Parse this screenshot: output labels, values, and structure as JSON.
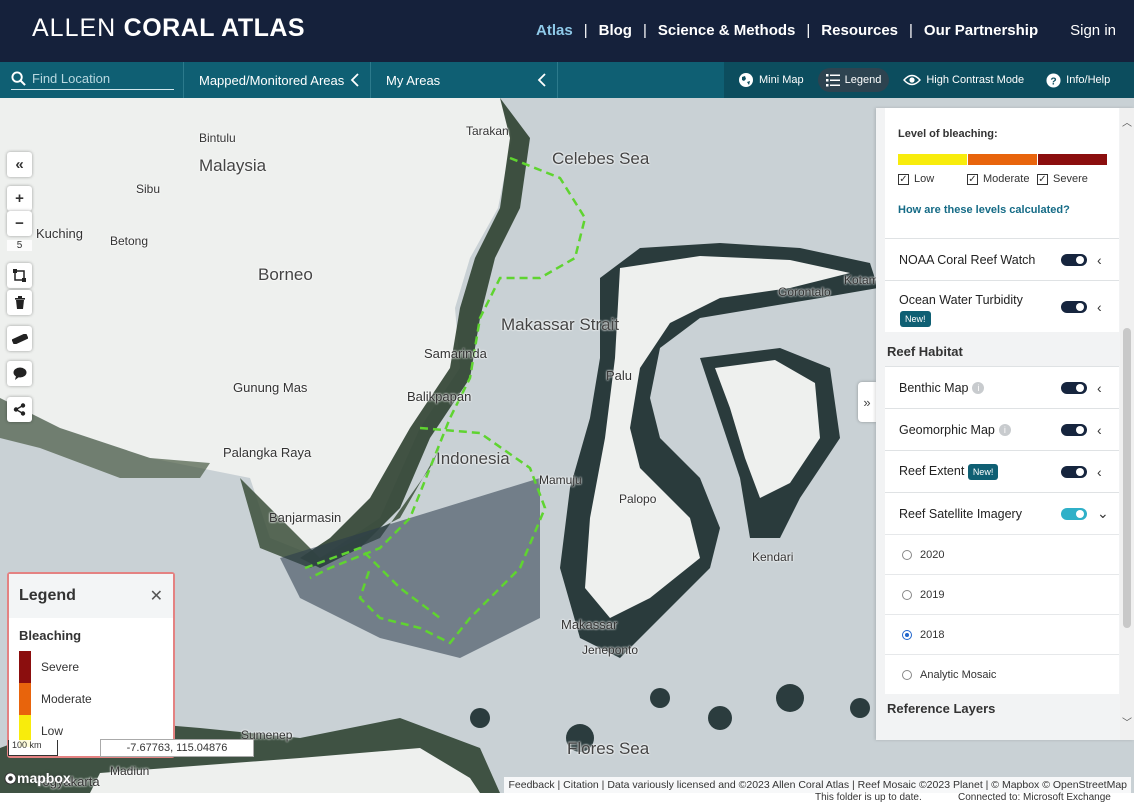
{
  "header": {
    "logo_thin": "ALLEN",
    "logo_bold": "CORAL ATLAS",
    "nav": [
      {
        "label": "Atlas"
      },
      {
        "label": "Blog"
      },
      {
        "label": "Science & Methods"
      },
      {
        "label": "Resources"
      },
      {
        "label": "Our Partnership"
      }
    ],
    "signin": "Sign in",
    "accent_color": "#8ec9e8",
    "bg_color": "#15213b"
  },
  "toolbar": {
    "search_placeholder": "Find Location",
    "mapped_label": "Mapped/Monitored Areas",
    "myareas_label": "My Areas",
    "minimap_label": "Mini Map",
    "legend_label": "Legend",
    "contrast_label": "High Contrast Mode",
    "info_label": "Info/Help"
  },
  "map": {
    "labels": {
      "bintulu": "Bintulu",
      "tarakan": "Tarakan",
      "celebes": "Celebes Sea",
      "malaysia": "Malaysia",
      "sibu": "Sibu",
      "kuching": "Kuching",
      "betong": "Betong",
      "borneo": "Borneo",
      "makassar_strait": "Makassar Strait",
      "gorontalo": "Gorontalo",
      "kotamobagu": "Kotam",
      "samarinda": "Samarinda",
      "palu": "Palu",
      "gunung_mas": "Gunung Mas",
      "balikpapan": "Balikpapan",
      "palangka": "Palangka Raya",
      "indonesia": "Indonesia",
      "mamuju": "Mamuju",
      "palopo": "Palopo",
      "banjarmasin": "Banjarmasin",
      "kendari": "Kendari",
      "makassar": "Makassar",
      "jeneponto": "Jeneponto",
      "flores": "Flores Sea",
      "sumenep": "Sumenep",
      "madiun": "Madiun",
      "yogyakarta": "Yogyakarta"
    },
    "zoom_level": "5",
    "scale_label": "100 km",
    "coords": "-7.67763, 115.04876",
    "mapbox": "mapbox",
    "attribution": "Feedback | Citation | Data variously licensed and ©2023 Allen Coral Atlas | Reef Mosaic ©2023 Planet | © Mapbox © OpenStreetMap"
  },
  "legend_popup": {
    "title": "Legend",
    "subtitle": "Bleaching",
    "items": [
      {
        "label": "Severe",
        "color": "#8b0e0e"
      },
      {
        "label": "Moderate",
        "color": "#e8640c"
      },
      {
        "label": "Low",
        "color": "#f8ec0c"
      }
    ]
  },
  "panel": {
    "bleaching_title": "Level of bleaching:",
    "checkboxes": [
      {
        "label": "Low",
        "checked": true
      },
      {
        "label": "Moderate",
        "checked": true
      },
      {
        "label": "Severe",
        "checked": true
      }
    ],
    "how_link": "How are these levels calculated?",
    "noaa": "NOAA Coral Reef Watch",
    "turbidity": "Ocean Water Turbidity",
    "new_badge": "New!",
    "reef_habitat_title": "Reef Habitat",
    "benthic": "Benthic Map",
    "geomorphic": "Geomorphic Map",
    "reef_extent": "Reef Extent",
    "satellite": "Reef Satellite Imagery",
    "years": [
      {
        "label": "2020",
        "selected": false
      },
      {
        "label": "2019",
        "selected": false
      },
      {
        "label": "2018",
        "selected": true
      },
      {
        "label": "Analytic Mosaic",
        "selected": false
      }
    ],
    "reference_title": "Reference Layers"
  },
  "status": {
    "left": "This folder is up to date.",
    "right": "Connected to: Microsoft Exchange"
  }
}
